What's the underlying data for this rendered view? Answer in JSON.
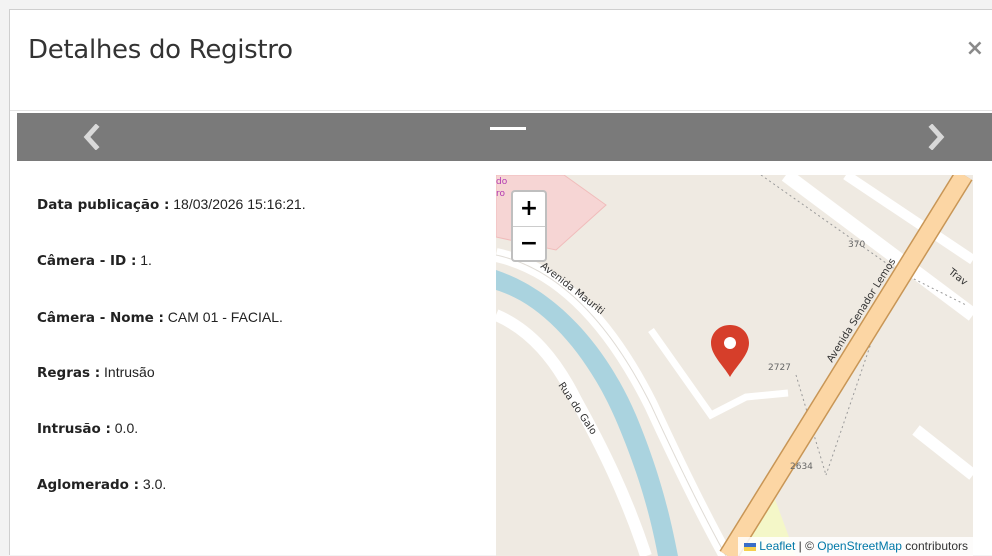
{
  "modal": {
    "title": "Detalhes do Registro",
    "close_label": "×"
  },
  "carousel": {
    "prev_icon": "chevron-left-icon",
    "next_icon": "chevron-right-icon",
    "indicator": "active-slide-indicator"
  },
  "details": [
    {
      "label": "Data publicação :",
      "value": " 18/03/2026 15:16:21."
    },
    {
      "label": "Câmera - ID :",
      "value": " 1."
    },
    {
      "label": "Câmera - Nome :",
      "value": " CAM 01 - FACIAL."
    },
    {
      "label": "Regras :",
      "value": " Intrusão"
    },
    {
      "label": "Intrusão :",
      "value": " 0.0."
    },
    {
      "label": "Aglomerado :",
      "value": " 3.0."
    }
  ],
  "map": {
    "zoom_in": "+",
    "zoom_out": "−",
    "streets": {
      "avenida_mauriti": "Avenida Mauriti",
      "avenida_senador_lemos": "Avenida Senador Lemos",
      "rua_do_galo": "Rua do Galo",
      "trav": "Trav"
    },
    "house_numbers": [
      "370",
      "2727",
      "2634"
    ],
    "poi_fragment": [
      "do",
      "ro"
    ],
    "attribution": {
      "leaflet": "Leaflet",
      "separator": " | © ",
      "osm": "OpenStreetMap",
      "contributors": " contributors"
    },
    "marker_color": "#d63e2a"
  }
}
